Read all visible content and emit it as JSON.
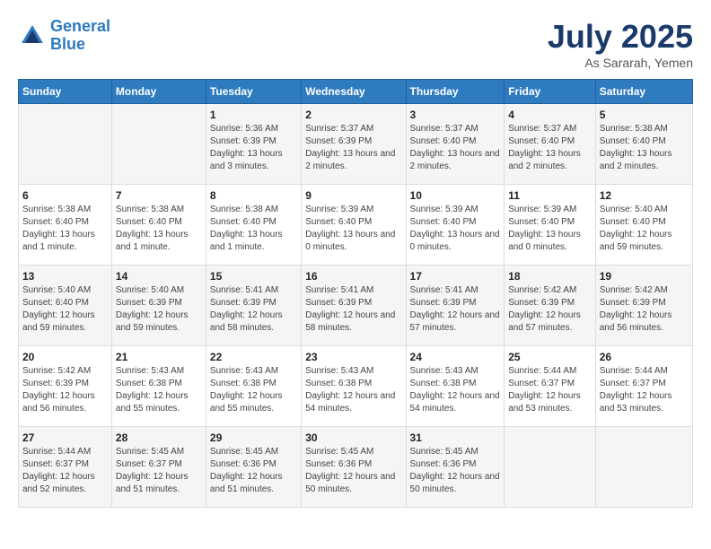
{
  "logo": {
    "line1": "General",
    "line2": "Blue"
  },
  "title": "July 2025",
  "subtitle": "As Sararah, Yemen",
  "days_of_week": [
    "Sunday",
    "Monday",
    "Tuesday",
    "Wednesday",
    "Thursday",
    "Friday",
    "Saturday"
  ],
  "weeks": [
    [
      {
        "day": "",
        "info": ""
      },
      {
        "day": "",
        "info": ""
      },
      {
        "day": "1",
        "info": "Sunrise: 5:36 AM\nSunset: 6:39 PM\nDaylight: 13 hours and 3 minutes."
      },
      {
        "day": "2",
        "info": "Sunrise: 5:37 AM\nSunset: 6:39 PM\nDaylight: 13 hours and 2 minutes."
      },
      {
        "day": "3",
        "info": "Sunrise: 5:37 AM\nSunset: 6:40 PM\nDaylight: 13 hours and 2 minutes."
      },
      {
        "day": "4",
        "info": "Sunrise: 5:37 AM\nSunset: 6:40 PM\nDaylight: 13 hours and 2 minutes."
      },
      {
        "day": "5",
        "info": "Sunrise: 5:38 AM\nSunset: 6:40 PM\nDaylight: 13 hours and 2 minutes."
      }
    ],
    [
      {
        "day": "6",
        "info": "Sunrise: 5:38 AM\nSunset: 6:40 PM\nDaylight: 13 hours and 1 minute."
      },
      {
        "day": "7",
        "info": "Sunrise: 5:38 AM\nSunset: 6:40 PM\nDaylight: 13 hours and 1 minute."
      },
      {
        "day": "8",
        "info": "Sunrise: 5:38 AM\nSunset: 6:40 PM\nDaylight: 13 hours and 1 minute."
      },
      {
        "day": "9",
        "info": "Sunrise: 5:39 AM\nSunset: 6:40 PM\nDaylight: 13 hours and 0 minutes."
      },
      {
        "day": "10",
        "info": "Sunrise: 5:39 AM\nSunset: 6:40 PM\nDaylight: 13 hours and 0 minutes."
      },
      {
        "day": "11",
        "info": "Sunrise: 5:39 AM\nSunset: 6:40 PM\nDaylight: 13 hours and 0 minutes."
      },
      {
        "day": "12",
        "info": "Sunrise: 5:40 AM\nSunset: 6:40 PM\nDaylight: 12 hours and 59 minutes."
      }
    ],
    [
      {
        "day": "13",
        "info": "Sunrise: 5:40 AM\nSunset: 6:40 PM\nDaylight: 12 hours and 59 minutes."
      },
      {
        "day": "14",
        "info": "Sunrise: 5:40 AM\nSunset: 6:39 PM\nDaylight: 12 hours and 59 minutes."
      },
      {
        "day": "15",
        "info": "Sunrise: 5:41 AM\nSunset: 6:39 PM\nDaylight: 12 hours and 58 minutes."
      },
      {
        "day": "16",
        "info": "Sunrise: 5:41 AM\nSunset: 6:39 PM\nDaylight: 12 hours and 58 minutes."
      },
      {
        "day": "17",
        "info": "Sunrise: 5:41 AM\nSunset: 6:39 PM\nDaylight: 12 hours and 57 minutes."
      },
      {
        "day": "18",
        "info": "Sunrise: 5:42 AM\nSunset: 6:39 PM\nDaylight: 12 hours and 57 minutes."
      },
      {
        "day": "19",
        "info": "Sunrise: 5:42 AM\nSunset: 6:39 PM\nDaylight: 12 hours and 56 minutes."
      }
    ],
    [
      {
        "day": "20",
        "info": "Sunrise: 5:42 AM\nSunset: 6:39 PM\nDaylight: 12 hours and 56 minutes."
      },
      {
        "day": "21",
        "info": "Sunrise: 5:43 AM\nSunset: 6:38 PM\nDaylight: 12 hours and 55 minutes."
      },
      {
        "day": "22",
        "info": "Sunrise: 5:43 AM\nSunset: 6:38 PM\nDaylight: 12 hours and 55 minutes."
      },
      {
        "day": "23",
        "info": "Sunrise: 5:43 AM\nSunset: 6:38 PM\nDaylight: 12 hours and 54 minutes."
      },
      {
        "day": "24",
        "info": "Sunrise: 5:43 AM\nSunset: 6:38 PM\nDaylight: 12 hours and 54 minutes."
      },
      {
        "day": "25",
        "info": "Sunrise: 5:44 AM\nSunset: 6:37 PM\nDaylight: 12 hours and 53 minutes."
      },
      {
        "day": "26",
        "info": "Sunrise: 5:44 AM\nSunset: 6:37 PM\nDaylight: 12 hours and 53 minutes."
      }
    ],
    [
      {
        "day": "27",
        "info": "Sunrise: 5:44 AM\nSunset: 6:37 PM\nDaylight: 12 hours and 52 minutes."
      },
      {
        "day": "28",
        "info": "Sunrise: 5:45 AM\nSunset: 6:37 PM\nDaylight: 12 hours and 51 minutes."
      },
      {
        "day": "29",
        "info": "Sunrise: 5:45 AM\nSunset: 6:36 PM\nDaylight: 12 hours and 51 minutes."
      },
      {
        "day": "30",
        "info": "Sunrise: 5:45 AM\nSunset: 6:36 PM\nDaylight: 12 hours and 50 minutes."
      },
      {
        "day": "31",
        "info": "Sunrise: 5:45 AM\nSunset: 6:36 PM\nDaylight: 12 hours and 50 minutes."
      },
      {
        "day": "",
        "info": ""
      },
      {
        "day": "",
        "info": ""
      }
    ]
  ]
}
